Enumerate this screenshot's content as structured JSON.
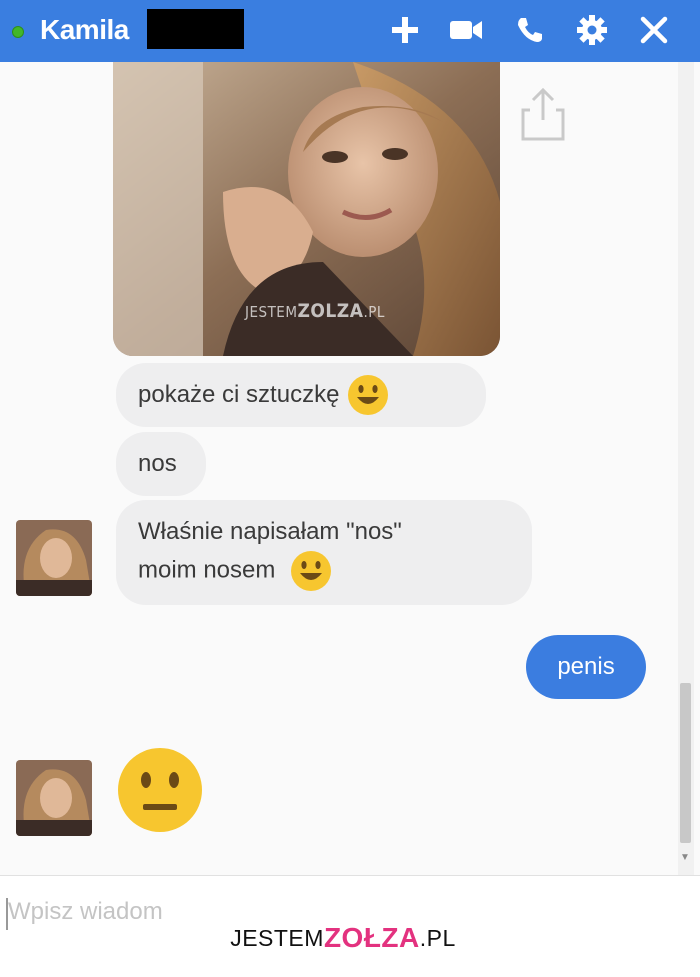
{
  "header": {
    "contact_name": "Kamila",
    "online_color": "#42b72a",
    "bar_color": "#3a7ee0",
    "icons": [
      "add-icon",
      "video-call-icon",
      "phone-icon",
      "gear-icon",
      "close-icon"
    ]
  },
  "watermark_photo": {
    "prefix": "JESTEM",
    "brand": "ZOLZA",
    "suffix": ".PL"
  },
  "messages": [
    {
      "from": "contact",
      "text": "pokaże ci sztuczkę",
      "emoji": "smile"
    },
    {
      "from": "contact",
      "text": "nos"
    },
    {
      "from": "contact",
      "line1": "Właśnie napisałam \"nos\"",
      "line2": "moim nosem",
      "emoji": "smile"
    },
    {
      "from": "me",
      "text": "penis",
      "color": "#3b7de0"
    },
    {
      "from": "contact",
      "emoji": "neutral-face"
    }
  ],
  "composer": {
    "placeholder": "Wpisz wiadom"
  },
  "watermark_footer": {
    "prefix": "JESTEM",
    "brand": "ZOŁZA",
    "suffix": ".PL",
    "accent": "#e3327f"
  }
}
